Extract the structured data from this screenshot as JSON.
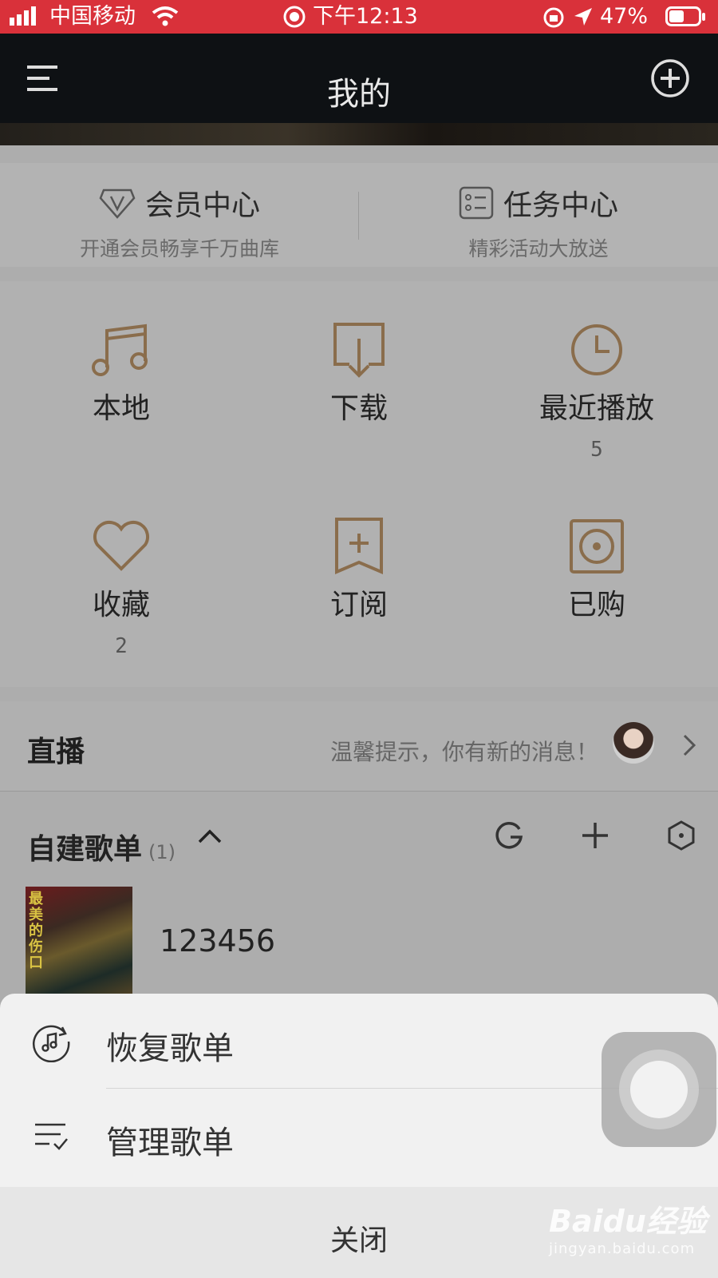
{
  "status_bar": {
    "carrier": "中国移动",
    "time": "下午12:13",
    "battery": "47%"
  },
  "header": {
    "title": "我的",
    "menu_icon": "menu-icon",
    "add_icon": "plus-circle-icon"
  },
  "vip": [
    {
      "title": "会员中心",
      "subtitle": "开通会员畅享千万曲库",
      "icon": "diamond-v-icon"
    },
    {
      "title": "任务中心",
      "subtitle": "精彩活动大放送",
      "icon": "task-list-icon"
    }
  ],
  "grid": [
    {
      "label": "本地",
      "count": "",
      "icon": "music-note-icon"
    },
    {
      "label": "下载",
      "count": "",
      "icon": "download-icon"
    },
    {
      "label": "最近播放",
      "count": "5",
      "icon": "clock-icon"
    },
    {
      "label": "收藏",
      "count": "2",
      "icon": "heart-icon"
    },
    {
      "label": "订阅",
      "count": "",
      "icon": "bookmark-plus-icon"
    },
    {
      "label": "已购",
      "count": "",
      "icon": "disc-icon"
    }
  ],
  "live": {
    "title": "直播",
    "message": "温馨提示，你有新的消息！"
  },
  "playlists": {
    "section_title": "自建歌单",
    "count": "(1)",
    "items": [
      {
        "name": "123456",
        "cover_text": "最美的伤口"
      }
    ]
  },
  "sheet": {
    "items": [
      {
        "label": "恢复歌单",
        "icon": "restore-music-icon"
      },
      {
        "label": "管理歌单",
        "icon": "manage-list-icon"
      }
    ],
    "close_label": "关闭"
  },
  "watermark": {
    "brand": "Baidu经验",
    "url": "jingyan.baidu.com"
  },
  "colors": {
    "status_bar": "#d9313a",
    "header_bg": "#0e1114",
    "accent_icon": "#8a6d4c"
  }
}
